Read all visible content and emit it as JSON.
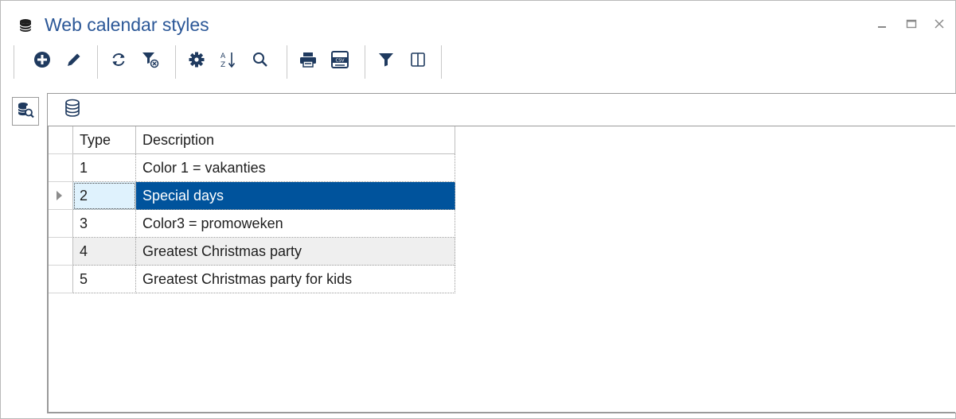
{
  "window": {
    "title": "Web calendar styles",
    "icon": "database-icon"
  },
  "toolbar": {
    "buttons": [
      {
        "icon": "add-icon"
      },
      {
        "icon": "edit-icon"
      },
      {
        "icon": "refresh-icon"
      },
      {
        "icon": "clear-filter-icon"
      },
      {
        "icon": "settings-icon"
      },
      {
        "icon": "sort-az-icon"
      },
      {
        "icon": "search-icon"
      },
      {
        "icon": "print-icon"
      },
      {
        "icon": "export-csv-icon"
      },
      {
        "icon": "filter-icon"
      },
      {
        "icon": "columns-icon"
      }
    ],
    "csv_label": "CSV"
  },
  "grid": {
    "columns": [
      "Type",
      "Description"
    ],
    "rows": [
      {
        "type": "1",
        "description": "Color 1 = vakanties"
      },
      {
        "type": "2",
        "description": "Special days"
      },
      {
        "type": "3",
        "description": "Color3 = promoweken"
      },
      {
        "type": "4",
        "description": "Greatest Christmas party"
      },
      {
        "type": "5",
        "description": "Greatest Christmas party for kids"
      }
    ],
    "selected_row": 2
  },
  "colors": {
    "title": "#2b5797",
    "selection": "#00539c",
    "icon": "#1f3a5f"
  }
}
